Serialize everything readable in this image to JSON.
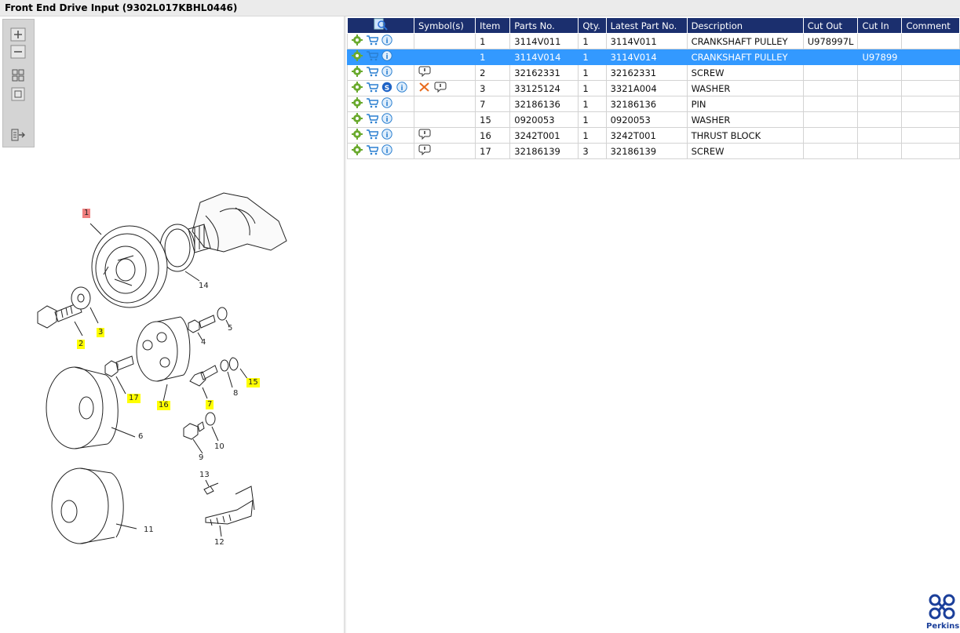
{
  "window": {
    "title": "Front End Drive Input (9302L017KBHL0446)"
  },
  "toolbox": {
    "buttons": [
      "zoom-in-icon",
      "zoom-out-icon",
      "fit-all-icon",
      "fit-selection-icon",
      "export-icon"
    ]
  },
  "diagram": {
    "callouts": [
      {
        "label": "1",
        "style": "selected"
      },
      {
        "label": "2",
        "style": "highlight"
      },
      {
        "label": "3",
        "style": "highlight"
      },
      {
        "label": "4",
        "style": "plain"
      },
      {
        "label": "5",
        "style": "plain"
      },
      {
        "label": "6",
        "style": "plain"
      },
      {
        "label": "7",
        "style": "highlight"
      },
      {
        "label": "8",
        "style": "plain"
      },
      {
        "label": "9",
        "style": "plain"
      },
      {
        "label": "10",
        "style": "plain"
      },
      {
        "label": "11",
        "style": "plain"
      },
      {
        "label": "12",
        "style": "plain"
      },
      {
        "label": "13",
        "style": "plain"
      },
      {
        "label": "14",
        "style": "plain"
      },
      {
        "label": "15",
        "style": "highlight"
      },
      {
        "label": "16",
        "style": "highlight"
      },
      {
        "label": "17",
        "style": "highlight"
      }
    ]
  },
  "table": {
    "columns": [
      "",
      "Symbol(s)",
      "Item",
      "Parts No.",
      "Qty.",
      "Latest Part No.",
      "Description",
      "Cut Out",
      "Cut In",
      "Comment"
    ],
    "rows": [
      {
        "symbols": [],
        "item": "1",
        "part_no": "3114V011",
        "qty": "1",
        "latest": "3114V011",
        "description": "CRANKSHAFT PULLEY",
        "cut_out": "U978997L",
        "cut_in": "",
        "comment": "",
        "service": false,
        "selected": false
      },
      {
        "symbols": [],
        "item": "1",
        "part_no": "3114V014",
        "qty": "1",
        "latest": "3114V014",
        "description": "CRANKSHAFT PULLEY",
        "cut_out": "",
        "cut_in": "U97899",
        "comment": "",
        "service": false,
        "selected": true
      },
      {
        "symbols": [
          "comment-icon"
        ],
        "item": "2",
        "part_no": "32162331",
        "qty": "1",
        "latest": "32162331",
        "description": "SCREW",
        "cut_out": "",
        "cut_in": "",
        "comment": "",
        "service": false,
        "selected": false
      },
      {
        "symbols": [
          "cross-icon",
          "comment-icon"
        ],
        "item": "3",
        "part_no": "33125124",
        "qty": "1",
        "latest": "3321A004",
        "description": "WASHER",
        "cut_out": "",
        "cut_in": "",
        "comment": "",
        "service": true,
        "selected": false
      },
      {
        "symbols": [],
        "item": "7",
        "part_no": "32186136",
        "qty": "1",
        "latest": "32186136",
        "description": "PIN",
        "cut_out": "",
        "cut_in": "",
        "comment": "",
        "service": false,
        "selected": false
      },
      {
        "symbols": [],
        "item": "15",
        "part_no": "0920053",
        "qty": "1",
        "latest": "0920053",
        "description": "WASHER",
        "cut_out": "",
        "cut_in": "",
        "comment": "",
        "service": false,
        "selected": false
      },
      {
        "symbols": [
          "comment-icon"
        ],
        "item": "16",
        "part_no": "3242T001",
        "qty": "1",
        "latest": "3242T001",
        "description": "THRUST BLOCK",
        "cut_out": "",
        "cut_in": "",
        "comment": "",
        "service": false,
        "selected": false
      },
      {
        "symbols": [
          "comment-icon"
        ],
        "item": "17",
        "part_no": "32186139",
        "qty": "3",
        "latest": "32186139",
        "description": "SCREW",
        "cut_out": "",
        "cut_in": "",
        "comment": "",
        "service": false,
        "selected": false
      }
    ]
  },
  "brand": {
    "name": "Perkins",
    "color": "#1b3f9a"
  },
  "colors": {
    "header_bg": "#1b2f6e",
    "selection": "#3399ff",
    "callout_highlight": "#ffff00",
    "callout_selected": "#f08080"
  }
}
